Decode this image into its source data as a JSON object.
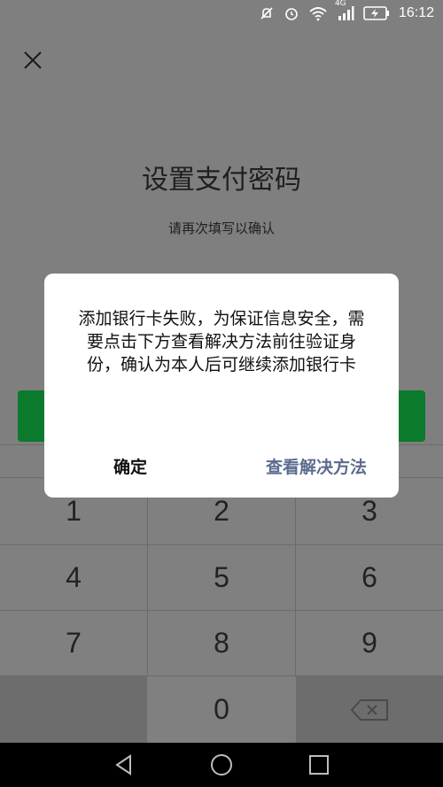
{
  "status_bar": {
    "time": "16:12",
    "network": "4G",
    "icons": [
      "no-notification-icon",
      "alarm-icon",
      "wifi-icon",
      "signal-icon",
      "battery-charging-icon"
    ]
  },
  "page": {
    "title": "设置支付密码",
    "subtitle": "请再次填写以确认"
  },
  "keypad": {
    "keys": [
      "1",
      "2",
      "3",
      "4",
      "5",
      "6",
      "7",
      "8",
      "9",
      "0"
    ]
  },
  "dialog": {
    "message": "添加银行卡失败，为保证信息安全，需要点击下方查看解决方法前往验证身份，确认为本人后可继续添加银行卡",
    "ok_label": "确定",
    "view_label": "查看解决方法"
  },
  "colors": {
    "overlay": "#7f7f7f",
    "primary_green": "#0b7a2c",
    "link_blue": "#5c6b8f"
  }
}
